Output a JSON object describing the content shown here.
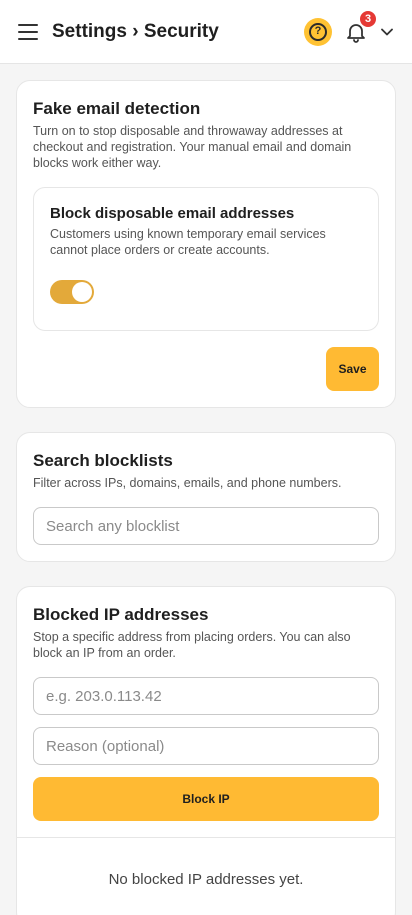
{
  "header": {
    "title": "Settings › Security",
    "notification_count": "3",
    "help_symbol": "?"
  },
  "fake_email": {
    "title": "Fake email detection",
    "description": "Turn on to stop disposable and throwaway addresses at checkout and registration. Your manual email and domain blocks work either way.",
    "option": {
      "title": "Block disposable email addresses",
      "description": "Customers using known temporary email services cannot place orders or create accounts.",
      "enabled": true
    },
    "save_label": "Save"
  },
  "search": {
    "title": "Search blocklists",
    "description": "Filter across IPs, domains, emails, and phone numbers.",
    "placeholder": "Search any blocklist"
  },
  "blocked_ip": {
    "title": "Blocked IP addresses",
    "description": "Stop a specific address from placing orders. You can also block an IP from an order.",
    "ip_placeholder": "e.g. 203.0.113.42",
    "reason_placeholder": "Reason (optional)",
    "button_label": "Block IP",
    "empty_text": "No blocked IP addresses yet."
  },
  "colors": {
    "accent": "#ffba33",
    "toggle_on": "#e3a93a",
    "badge": "#e53935"
  }
}
